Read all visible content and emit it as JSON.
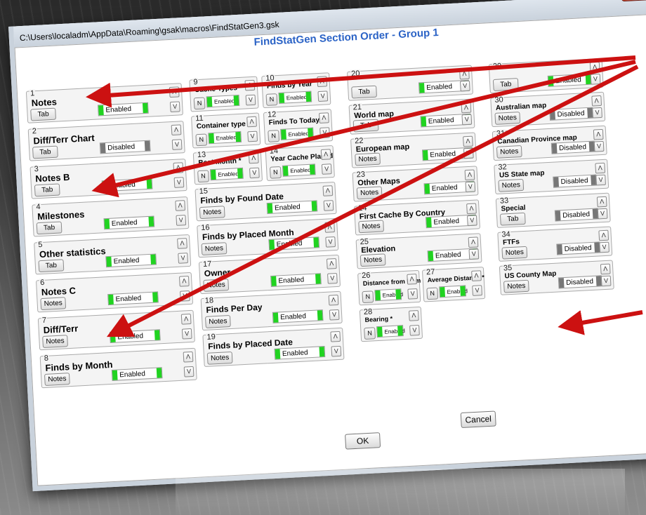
{
  "window": {
    "path_title": "C:\\Users\\localadm\\AppData\\Roaming\\gsak\\macros\\FindStatGen3.gsk",
    "close_label": "x",
    "heading": "FindStatGen Section Order - Group 1"
  },
  "sections": [
    {
      "num": "1",
      "label": "Notes",
      "button": "Tab",
      "status": "Enabled"
    },
    {
      "num": "2",
      "label": "Diff/Terr Chart",
      "button": "Tab",
      "status": "Disabled"
    },
    {
      "num": "3",
      "label": "Notes B",
      "button": "Tab",
      "status": "Enabled"
    },
    {
      "num": "4",
      "label": "Milestones",
      "button": "Tab",
      "status": "Enabled"
    },
    {
      "num": "5",
      "label": "Other statistics",
      "button": "Tab",
      "status": "Enabled"
    },
    {
      "num": "6",
      "label": "Notes C",
      "button": "Notes",
      "status": "Enabled"
    },
    {
      "num": "7",
      "label": "Diff/Terr",
      "button": "Notes",
      "status": "Enabled"
    },
    {
      "num": "8",
      "label": "Finds by Month",
      "button": "Notes",
      "status": "Enabled"
    },
    {
      "num": "9",
      "label": "Cache Types",
      "button": "N",
      "status": "Enabled"
    },
    {
      "num": "10",
      "label": "Finds by Year",
      "button": "N",
      "status": "Enabled"
    },
    {
      "num": "11",
      "label": "Container type *",
      "button": "N",
      "status": "Enabled"
    },
    {
      "num": "12",
      "label": "Finds To Today *",
      "button": "N",
      "status": "Enabled"
    },
    {
      "num": "13",
      "label": "Best Month *",
      "button": "N",
      "status": "Enabled"
    },
    {
      "num": "14",
      "label": "Year Cache Placed",
      "button": "N",
      "status": "Enabled"
    },
    {
      "num": "15",
      "label": "Finds by Found Date",
      "button": "Notes",
      "status": "Enabled"
    },
    {
      "num": "16",
      "label": "Finds by Placed Month",
      "button": "Notes",
      "status": "Enabled"
    },
    {
      "num": "17",
      "label": "Owner",
      "button": "Notes",
      "status": "Enabled"
    },
    {
      "num": "18",
      "label": "Finds Per Day",
      "button": "Notes",
      "status": "Enabled"
    },
    {
      "num": "19",
      "label": "Finds by Placed Date",
      "button": "Notes",
      "status": "Enabled"
    },
    {
      "num": "20",
      "label": "",
      "button": "Tab",
      "status": "Enabled"
    },
    {
      "num": "21",
      "label": "World map",
      "button": "Tab",
      "status": "Enabled"
    },
    {
      "num": "22",
      "label": "European map",
      "button": "Notes",
      "status": "Enabled"
    },
    {
      "num": "23",
      "label": "Other Maps",
      "button": "Notes",
      "status": "Enabled"
    },
    {
      "num": "24",
      "label": "First Cache By Country",
      "button": "Notes",
      "status": "Enabled"
    },
    {
      "num": "25",
      "label": "Elevation",
      "button": "Notes",
      "status": "Enabled"
    },
    {
      "num": "26",
      "label": "Distance from Hom",
      "button": "N",
      "status": "Enabled"
    },
    {
      "num": "27",
      "label": "Average Distance *",
      "button": "N",
      "status": "Enabled"
    },
    {
      "num": "28",
      "label": "Bearing *",
      "button": "N",
      "status": "Enabled"
    },
    {
      "num": "29",
      "label": "",
      "button": "Tab",
      "status": "Enabled"
    },
    {
      "num": "30",
      "label": "Australian map",
      "button": "Notes",
      "status": "Disabled"
    },
    {
      "num": "31",
      "label": "Canadian Province map",
      "button": "Notes",
      "status": "Disabled"
    },
    {
      "num": "32",
      "label": "US State map",
      "button": "Notes",
      "status": "Disabled"
    },
    {
      "num": "33",
      "label": "Special",
      "button": "Tab",
      "status": "Disabled"
    },
    {
      "num": "34",
      "label": "FTFs",
      "button": "Notes",
      "status": "Disabled"
    },
    {
      "num": "35",
      "label": "US County Map",
      "button": "Notes",
      "status": "Disabled"
    }
  ],
  "buttons": {
    "ok": "OK",
    "cancel": "Cancel"
  },
  "arrow_glyphs": {
    "up": "Λ",
    "down": "V"
  },
  "colors": {
    "enabled": "#21d321",
    "disabled": "#777777",
    "heading": "#2b63c6",
    "annotation_arrow": "#cc1111"
  },
  "reflection": {
    "ok": "OK",
    "cancel": "Cancel",
    "enabled": "Enabled",
    "county": "US County Map"
  }
}
